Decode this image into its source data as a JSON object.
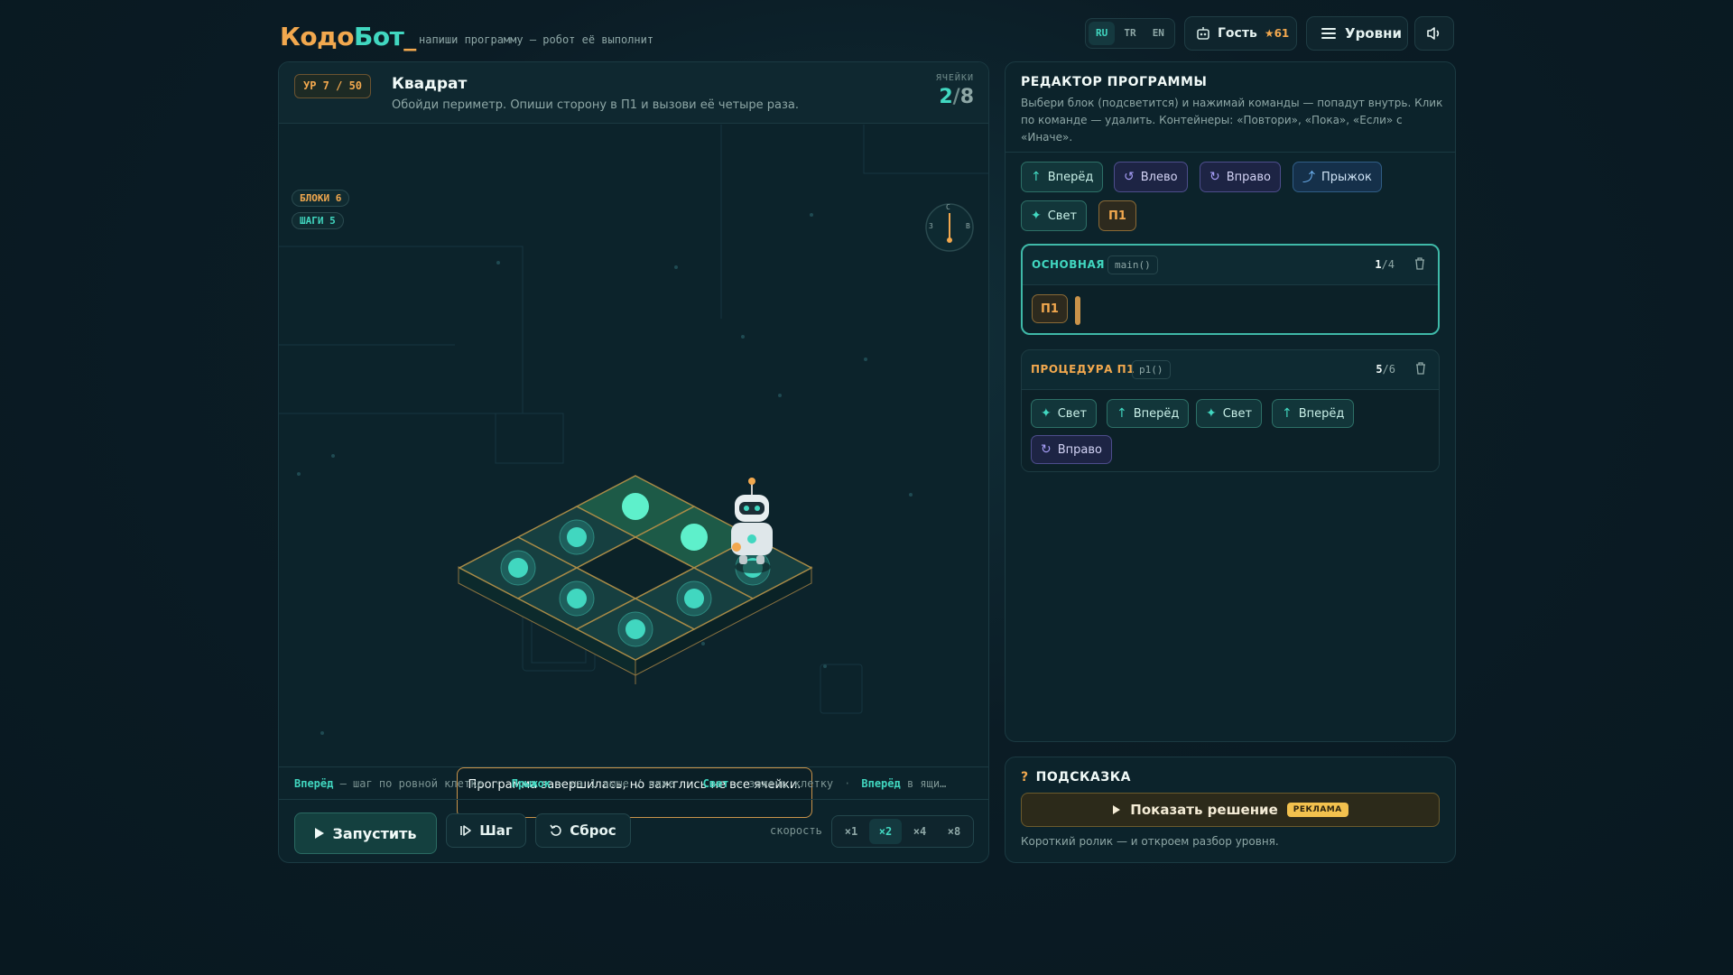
{
  "header": {
    "logo_part1": "Кодо",
    "logo_part2": "Бот",
    "logo_cursor": "_",
    "tagline": "напиши программу — робот её выполнит",
    "languages": [
      {
        "label": "RU",
        "active": true
      },
      {
        "label": "TR",
        "active": false
      },
      {
        "label": "EN",
        "active": false
      }
    ],
    "user_name": "Гость",
    "user_stars": "★61",
    "levels_label": "Уровни"
  },
  "level": {
    "badge": "УР 7 / 50",
    "title": "Квадрат",
    "description": "Обойди периметр. Опиши сторону в П1 и вызови её четыре раза.",
    "cells_label": "ЯЧЕЙКИ",
    "cells_lit": "2",
    "cells_sep": "/",
    "cells_total": "8",
    "blocks_pill": "БЛОКИ 6",
    "steps_pill": "ШАГИ 5",
    "compass": {
      "n": "С",
      "w": "З",
      "e": "В"
    },
    "message": "Программа завершилась, но зажглись не все ячейки."
  },
  "legend": [
    {
      "key": "Вперёд",
      "text": " — шаг по ровной клетке"
    },
    {
      "key": "Прыжок",
      "text": " — на 1 выше / ниже"
    },
    {
      "key": "Свет",
      "text": " — зажечь клетку"
    },
    {
      "key": "Вперёд",
      "text": " в ящи…"
    }
  ],
  "controls": {
    "run": "Запустить",
    "step": "Шаг",
    "reset": "Сброс",
    "speed_label": "скорость",
    "speeds": [
      {
        "label": "×1",
        "active": false
      },
      {
        "label": "×2",
        "active": true
      },
      {
        "label": "×4",
        "active": false
      },
      {
        "label": "×8",
        "active": false
      }
    ]
  },
  "editor": {
    "title": "РЕДАКТОР ПРОГРАММЫ",
    "description": "Выбери блок (подсветится) и нажимай команды — попадут внутрь. Клик по команде — удалить. Контейнеры: «Повтори», «Пока», «Если» с «Иначе».",
    "palette": [
      {
        "label": "Вперёд",
        "icon": "arrow-up-icon",
        "kind": "green"
      },
      {
        "label": "Влево",
        "icon": "rotate-left-icon",
        "kind": "purple"
      },
      {
        "label": "Вправо",
        "icon": "rotate-right-icon",
        "kind": "purple"
      },
      {
        "label": "Прыжок",
        "icon": "jump-icon",
        "kind": "blue"
      },
      {
        "label": "Свет",
        "icon": "sparkle-icon",
        "kind": "green"
      },
      {
        "label": "П1",
        "icon": "",
        "kind": "orange"
      }
    ],
    "main": {
      "title": "ОСНОВНАЯ",
      "fn": "main()",
      "count_used": "1",
      "count_max": "/4",
      "commands": [
        "П1"
      ]
    },
    "proc": {
      "title": "ПРОЦЕДУРА П1",
      "fn": "p1()",
      "count_used": "5",
      "count_max": "/6",
      "commands": [
        {
          "label": "Свет",
          "kind": "green"
        },
        {
          "label": "Вперёд",
          "kind": "green"
        },
        {
          "label": "Свет",
          "kind": "green"
        },
        {
          "label": "Вперёд",
          "kind": "green"
        },
        {
          "label": "Вправо",
          "kind": "purple"
        }
      ]
    }
  },
  "hint": {
    "q": "?",
    "title": "ПОДСКАЗКА",
    "button": "Показать решение",
    "ad_badge": "РЕКЛАМА",
    "note": "Короткий ролик — и откроем разбор уровня."
  },
  "colors": {
    "accent_teal": "#41d7c0",
    "accent_orange": "#f2a84e",
    "background": "#0b1c25"
  }
}
